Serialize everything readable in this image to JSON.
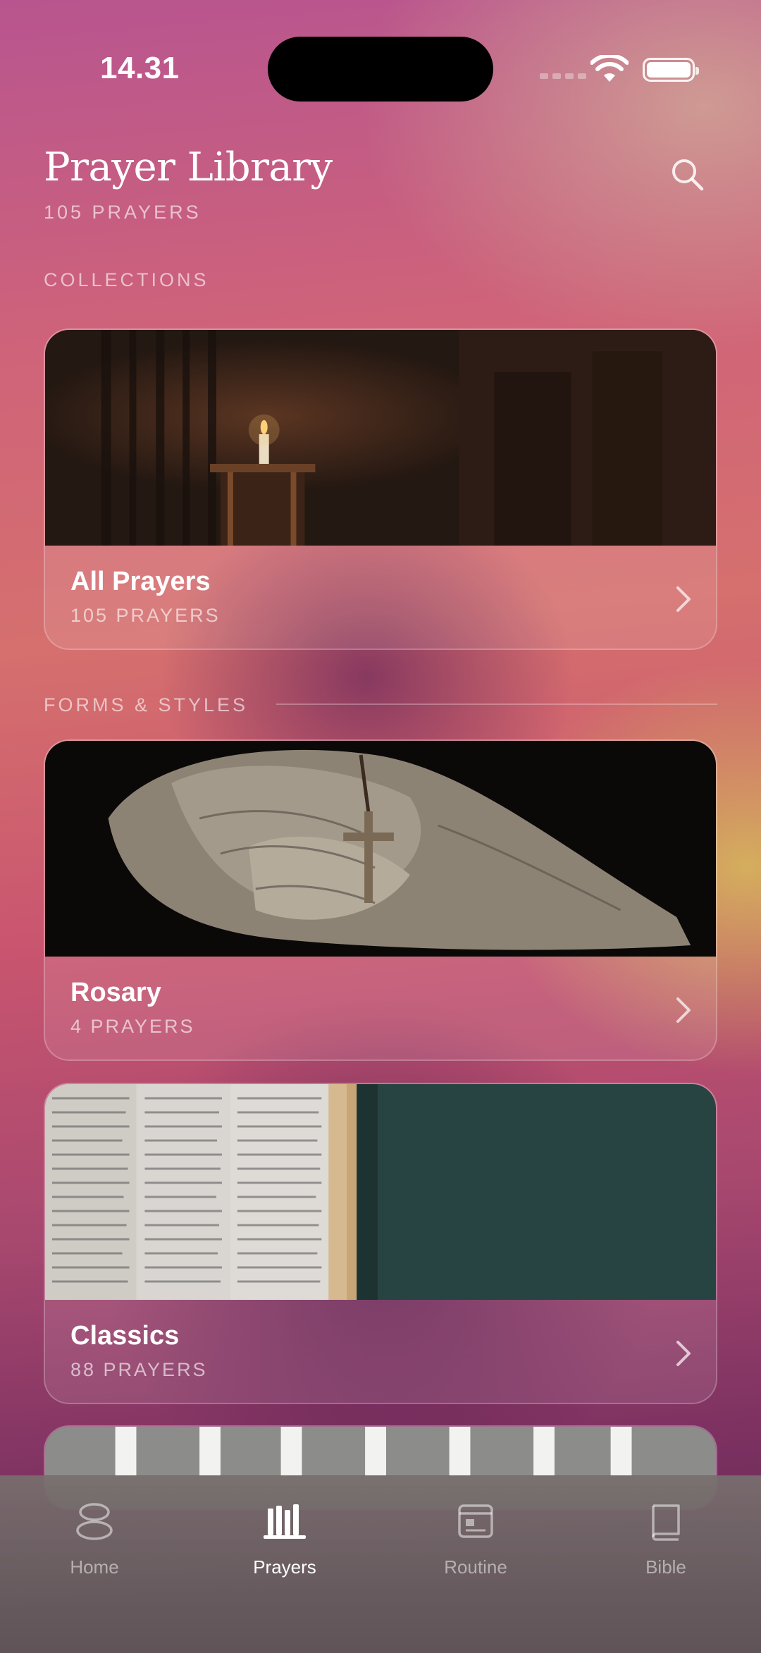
{
  "status_bar": {
    "time": "14.31"
  },
  "header": {
    "title": "Prayer Library",
    "subtitle": "105 PRAYERS",
    "search_icon": "search-icon"
  },
  "sections": {
    "collections": "COLLECTIONS",
    "forms_styles": "FORMS & STYLES"
  },
  "cards": [
    {
      "title": "All Prayers",
      "count": "105 PRAYERS",
      "image": "candle-on-lectern"
    },
    {
      "title": "Rosary",
      "count": "4 PRAYERS",
      "image": "hands-with-rosary"
    },
    {
      "title": "Classics",
      "count": "88 PRAYERS",
      "image": "open-bible"
    }
  ],
  "tabs": [
    {
      "label": "Home",
      "icon": "home-icon",
      "active": false
    },
    {
      "label": "Prayers",
      "icon": "prayers-icon",
      "active": true
    },
    {
      "label": "Routine",
      "icon": "routine-icon",
      "active": false
    },
    {
      "label": "Bible",
      "icon": "bible-icon",
      "active": false
    }
  ]
}
